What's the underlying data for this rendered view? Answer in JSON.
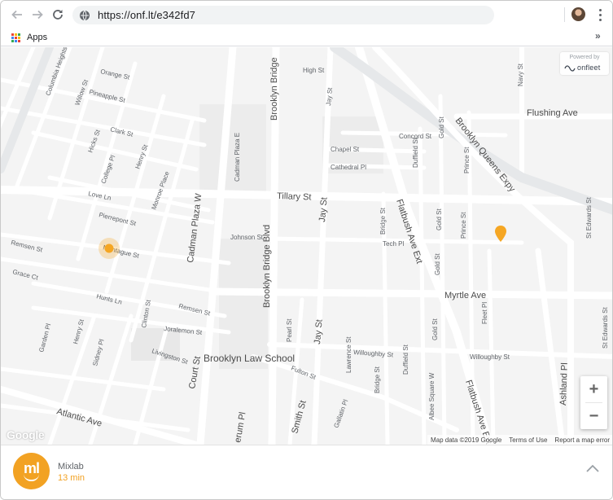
{
  "browser": {
    "url": "https://onf.lt/e342fd7",
    "bookmarks": {
      "apps_label": "Apps",
      "more_icon": "chevrons-right-icon"
    },
    "icons": [
      "back-arrow-icon",
      "forward-arrow-icon",
      "reload-icon",
      "site-info-icon",
      "profile-avatar",
      "menu-dots-icon"
    ]
  },
  "map": {
    "powered_by": "Powered by",
    "brand": "onfleet",
    "street_labels": {
      "columbia_heights": "Columbia Heights",
      "orange_st": "Orange St",
      "willow_st": "Willow St",
      "pineapple_st": "Pineapple St",
      "clark_st": "Clark St",
      "hicks_st": "Hicks St",
      "college_pl": "College Pl",
      "henry_st": "Henry St",
      "monroe_place": "Monroe Place",
      "love_ln": "Love Ln",
      "pierrepont_st": "Pierrepont St",
      "remsen_st_w": "Remsen St",
      "grace_ct": "Grace Ct",
      "montague_st": "Montague St",
      "hunts_ln": "Hunts Ln",
      "clinton_st": "Clinton St",
      "remsen_st_e": "Remsen St",
      "joralemon_st": "Joralemon St",
      "garden_pl": "Garden Pl",
      "henry_st_s": "Henry St",
      "sidney_pl": "Sidney Pl",
      "livingston_st": "Livingston St",
      "atlantic_ave": "Atlantic Ave",
      "cadman_plaza_w": "Cadman Plaza W",
      "cadman_plaza_e": "Cadman Plaza E",
      "brooklyn_bridge": "Brooklyn Bridge",
      "brooklyn_bridge_blvd": "Brooklyn Bridge Blvd",
      "johnson_st": "Johnson St",
      "court_st": "Court St",
      "high_st": "High St",
      "jay_st_n": "Jay St",
      "jay_st_mid": "Jay St",
      "jay_st_s": "Jay St",
      "tillary_st": "Tillary St",
      "concord_st": "Concord St",
      "chapel_st": "Chapel St",
      "cathedral_pl": "Cathedral Pl",
      "gold_st_n": "Gold St",
      "duffield_st_n": "Duffield St",
      "prince_st_n": "Prince St",
      "brooklyn_queens_expy": "Brooklyn Queens Expy",
      "flushing_ave": "Flushing Ave",
      "navy_st": "Navy St",
      "st_edwards_st_n": "St Edwards St",
      "st_edwards_st_s": "St Edwards St",
      "bridge_st_n": "Bridge St",
      "flatbush_ave_ext_n": "Flatbush Ave Ext",
      "gold_st_mid": "Gold St",
      "prince_st_mid": "Prince St",
      "tech_pl": "Tech Pl",
      "gold_st_s": "Gold St",
      "myrtle_ave": "Myrtle Ave",
      "fleet_pl": "Fleet Pl",
      "pearl_st": "Pearl St",
      "willoughby_st_w": "Willoughby St",
      "willoughby_st_e": "Willoughby St",
      "lawrence_st": "Lawrence St",
      "duffield_st_s": "Duffield St",
      "gold_st_far": "Gold St",
      "bridge_st_s": "Bridge St",
      "albee_square_w": "Albee Square W",
      "flatbush_ave_ext_s": "Flatbush Ave Ext",
      "fulton_st": "Fulton St",
      "gallatin_pl": "Gallatin Pl",
      "smith_st": "Smith St",
      "boerum_pl": "erum Pl",
      "ashland_pl": "Ashland Pl",
      "brooklyn_law_school": "Brooklyn Law School"
    },
    "zoom": {
      "in": "+",
      "out": "−"
    },
    "google_logo": "Google",
    "attribution": {
      "map_data": "Map data ©2019 Google",
      "terms": "Terms of Use",
      "report": "Report a map error"
    },
    "colors": {
      "marker": "#f5a623",
      "route_bg": "#f4f4f4",
      "road": "#ffffff"
    }
  },
  "destination": {
    "logo_text": "ml",
    "name": "Mixlab",
    "eta": "13 min",
    "accent": "#f2a223",
    "expand_icon": "chevron-up-icon"
  }
}
